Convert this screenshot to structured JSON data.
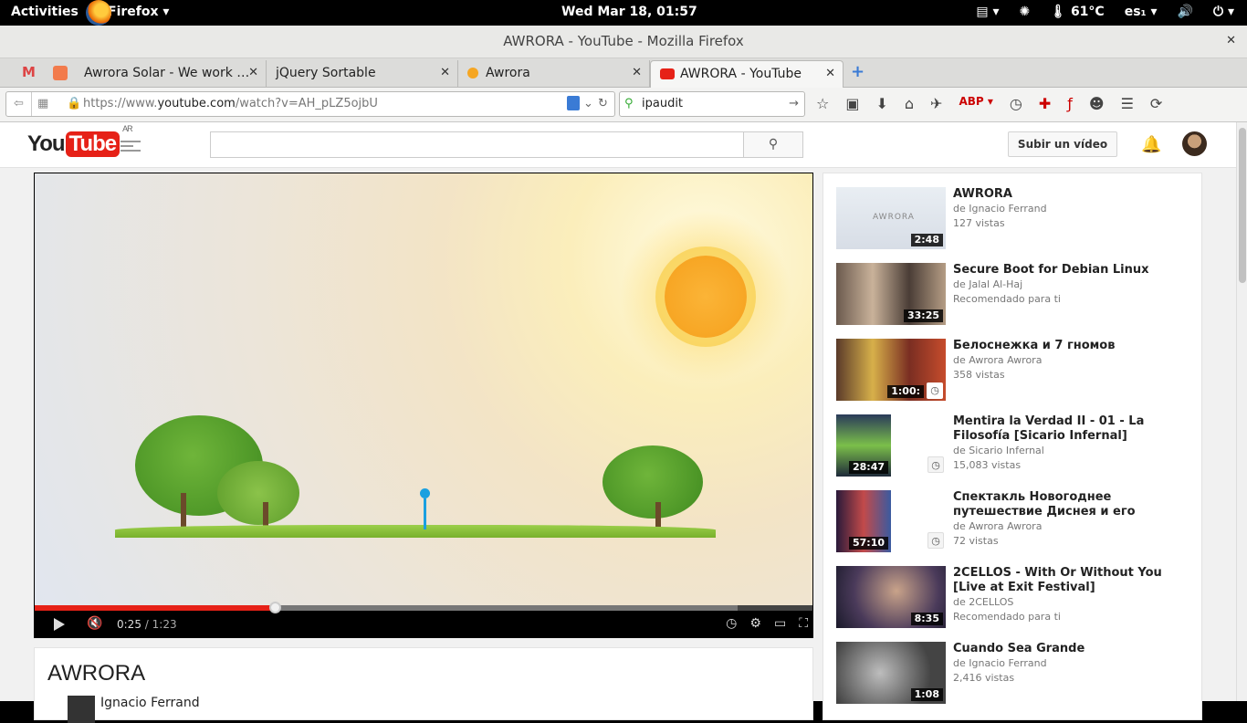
{
  "topbar": {
    "activities": "Activities",
    "app": "Firefox",
    "clock": "Wed Mar 18, 01:57",
    "temp": "61°C",
    "lang": "es₁"
  },
  "window": {
    "title": "AWRORA - YouTube - Mozilla Firefox"
  },
  "tabs": [
    {
      "label": "Awrora Solar - We work …"
    },
    {
      "label": "jQuery Sortable"
    },
    {
      "label": "Awrora"
    },
    {
      "label": "AWRORA - YouTube"
    }
  ],
  "nav": {
    "url_prefix": "https://www.",
    "url_domain": "youtube.com",
    "url_path": "/watch?v=AH_pLZ5ojbU",
    "search_value": "ipaudit"
  },
  "youtube": {
    "logo_you": "You",
    "logo_tube": "Tube",
    "region": "AR",
    "upload_label": "Subir un vídeo",
    "current_time": "0:25",
    "duration": "1:23",
    "progress_fraction": 0.31,
    "video_title": "AWRORA",
    "owner": "Ignacio Ferrand"
  },
  "related": [
    {
      "title": "AWRORA",
      "channel": "de Ignacio Ferrand",
      "info": "127 vistas",
      "duration": "2:48"
    },
    {
      "title": "Secure Boot for Debian Linux",
      "channel": "de Jalal Al-Haj",
      "info": "Recomendado para ti",
      "duration": "33:25"
    },
    {
      "title": "Белоснежка и 7 гномов",
      "channel": "de Awrora Awrora",
      "info": "358 vistas",
      "duration": "1:00:"
    },
    {
      "title": "Mentira la Verdad II - 01 - La Filosofía [Sicario Infernal]",
      "channel": "de Sicario Infernal",
      "info": "15,083 vistas",
      "duration": "28:47"
    },
    {
      "title": "Спектакль Новогоднее путешествие Диснея и его",
      "channel": "de Awrora Awrora",
      "info": "72 vistas",
      "duration": "57:10"
    },
    {
      "title": "2CELLOS - With Or Without You [Live at Exit Festival]",
      "channel": "de 2CELLOS",
      "info": "Recomendado para ti",
      "duration": "8:35"
    },
    {
      "title": "Cuando Sea Grande",
      "channel": "de Ignacio Ferrand",
      "info": "2,416 vistas",
      "duration": "1:08"
    }
  ]
}
